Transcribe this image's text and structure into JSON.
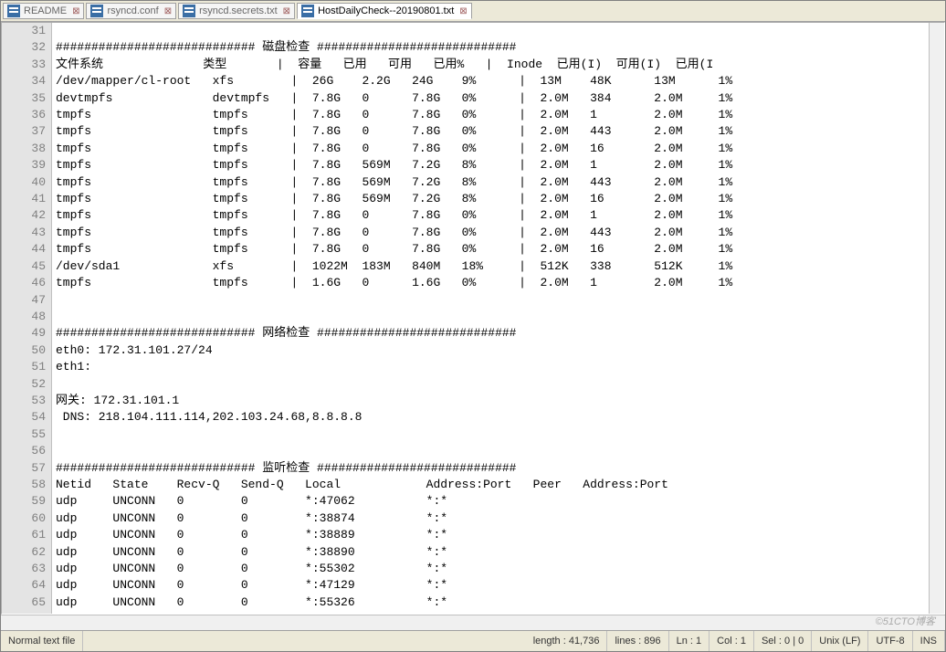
{
  "tabs": [
    {
      "label": "README",
      "active": false
    },
    {
      "label": "rsyncd.conf",
      "active": false
    },
    {
      "label": "rsyncd.secrets.txt",
      "active": false
    },
    {
      "label": "HostDailyCheck--20190801.txt",
      "active": true
    }
  ],
  "lines": [
    {
      "n": 31,
      "t": ""
    },
    {
      "n": 32,
      "t": "############################ 磁盘检查 ############################"
    },
    {
      "n": 33,
      "t": "文件系统              类型       |  容量   已用   可用   已用%   |  Inode  已用(I)  可用(I)  已用(I"
    },
    {
      "n": 34,
      "t": "/dev/mapper/cl-root   xfs        |  26G    2.2G   24G    9%      |  13M    48K      13M      1%"
    },
    {
      "n": 35,
      "t": "devtmpfs              devtmpfs   |  7.8G   0      7.8G   0%      |  2.0M   384      2.0M     1%"
    },
    {
      "n": 36,
      "t": "tmpfs                 tmpfs      |  7.8G   0      7.8G   0%      |  2.0M   1        2.0M     1%"
    },
    {
      "n": 37,
      "t": "tmpfs                 tmpfs      |  7.8G   0      7.8G   0%      |  2.0M   443      2.0M     1%"
    },
    {
      "n": 38,
      "t": "tmpfs                 tmpfs      |  7.8G   0      7.8G   0%      |  2.0M   16       2.0M     1%"
    },
    {
      "n": 39,
      "t": "tmpfs                 tmpfs      |  7.8G   569M   7.2G   8%      |  2.0M   1        2.0M     1%"
    },
    {
      "n": 40,
      "t": "tmpfs                 tmpfs      |  7.8G   569M   7.2G   8%      |  2.0M   443      2.0M     1%"
    },
    {
      "n": 41,
      "t": "tmpfs                 tmpfs      |  7.8G   569M   7.2G   8%      |  2.0M   16       2.0M     1%"
    },
    {
      "n": 42,
      "t": "tmpfs                 tmpfs      |  7.8G   0      7.8G   0%      |  2.0M   1        2.0M     1%"
    },
    {
      "n": 43,
      "t": "tmpfs                 tmpfs      |  7.8G   0      7.8G   0%      |  2.0M   443      2.0M     1%"
    },
    {
      "n": 44,
      "t": "tmpfs                 tmpfs      |  7.8G   0      7.8G   0%      |  2.0M   16       2.0M     1%"
    },
    {
      "n": 45,
      "t": "/dev/sda1             xfs        |  1022M  183M   840M   18%     |  512K   338      512K     1%"
    },
    {
      "n": 46,
      "t": "tmpfs                 tmpfs      |  1.6G   0      1.6G   0%      |  2.0M   1        2.0M     1%"
    },
    {
      "n": 47,
      "t": ""
    },
    {
      "n": 48,
      "t": ""
    },
    {
      "n": 49,
      "t": "############################ 网络检查 ############################"
    },
    {
      "n": 50,
      "t": "eth0: 172.31.101.27/24"
    },
    {
      "n": 51,
      "t": "eth1:"
    },
    {
      "n": 52,
      "t": ""
    },
    {
      "n": 53,
      "t": "网关: 172.31.101.1"
    },
    {
      "n": 54,
      "t": " DNS: 218.104.111.114,202.103.24.68,8.8.8.8"
    },
    {
      "n": 55,
      "t": ""
    },
    {
      "n": 56,
      "t": ""
    },
    {
      "n": 57,
      "t": "############################ 监听检查 ############################"
    },
    {
      "n": 58,
      "t": "Netid   State    Recv-Q   Send-Q   Local            Address:Port   Peer   Address:Port"
    },
    {
      "n": 59,
      "t": "udp     UNCONN   0        0        *:47062          *:*"
    },
    {
      "n": 60,
      "t": "udp     UNCONN   0        0        *:38874          *:*"
    },
    {
      "n": 61,
      "t": "udp     UNCONN   0        0        *:38889          *:*"
    },
    {
      "n": 62,
      "t": "udp     UNCONN   0        0        *:38890          *:*"
    },
    {
      "n": 63,
      "t": "udp     UNCONN   0        0        *:55302          *:*"
    },
    {
      "n": 64,
      "t": "udp     UNCONN   0        0        *:47129          *:*"
    },
    {
      "n": 65,
      "t": "udp     UNCONN   0        0        *:55326          *:*"
    }
  ],
  "status": {
    "mode": "Normal text file",
    "length": "length : 41,736",
    "lines": "lines : 896",
    "ln": "Ln : 1",
    "col": "Col : 1",
    "sel": "Sel : 0 | 0",
    "eol": "Unix (LF)",
    "enc": "UTF-8",
    "ins": "INS"
  },
  "watermark": "©51CTO博客"
}
